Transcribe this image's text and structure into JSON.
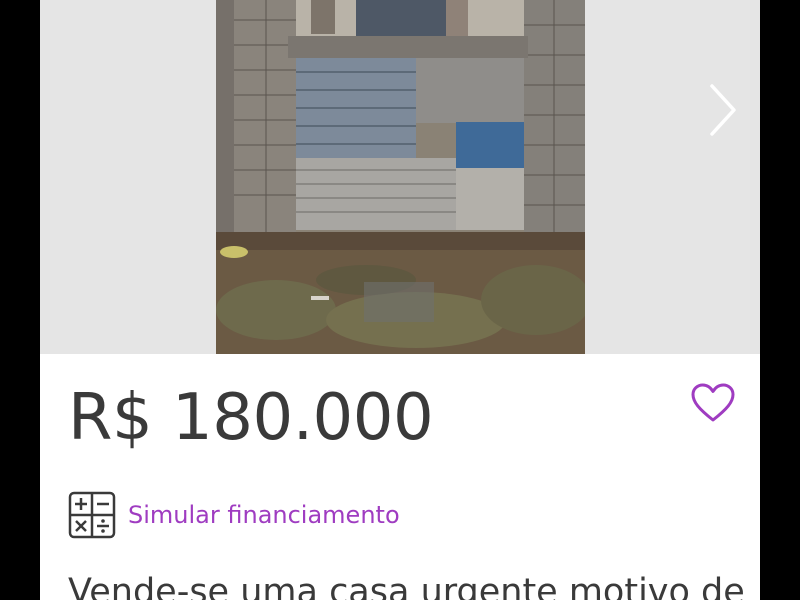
{
  "listing": {
    "price": "R$ 180.000",
    "simulate_label": "Simular financiamento",
    "description": "Vende-se uma casa urgente motivo de"
  },
  "gallery": {
    "photo_alt": "",
    "next_icon": "chevron-right-icon"
  },
  "icons": {
    "favorite": "heart-outline-icon",
    "calculator": "calculator-icon"
  },
  "colors": {
    "background": "#000000",
    "card": "#ffffff",
    "gallery_bg": "#e5e5e5",
    "price_text": "#3a3a3a",
    "accent": "#9f3cc1"
  }
}
